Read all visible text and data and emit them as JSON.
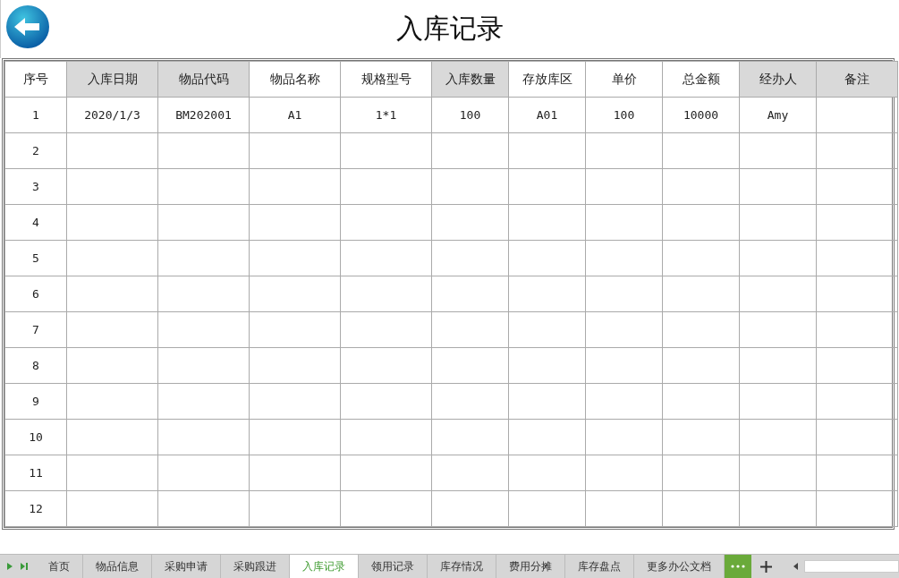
{
  "title": "入库记录",
  "table": {
    "columns": [
      {
        "label": "序号",
        "shaded": false
      },
      {
        "label": "入库日期",
        "shaded": true
      },
      {
        "label": "物品代码",
        "shaded": true
      },
      {
        "label": "物品名称",
        "shaded": false
      },
      {
        "label": "规格型号",
        "shaded": false
      },
      {
        "label": "入库数量",
        "shaded": true
      },
      {
        "label": "存放库区",
        "shaded": false
      },
      {
        "label": "单价",
        "shaded": false
      },
      {
        "label": "总金额",
        "shaded": false
      },
      {
        "label": "经办人",
        "shaded": true
      },
      {
        "label": "备注",
        "shaded": true
      }
    ],
    "rows": [
      [
        "1",
        "2020/1/3",
        "BM202001",
        "A1",
        "1*1",
        "100",
        "A01",
        "100",
        "10000",
        "Amy"
      ],
      [
        "2"
      ],
      [
        "3"
      ],
      [
        "4"
      ],
      [
        "5"
      ],
      [
        "6"
      ],
      [
        "7"
      ],
      [
        "8"
      ],
      [
        "9"
      ],
      [
        "10"
      ],
      [
        "11"
      ],
      [
        "12"
      ]
    ]
  },
  "sheet_tabs": [
    {
      "label": "首页",
      "selected": false
    },
    {
      "label": "物品信息",
      "selected": false
    },
    {
      "label": "采购申请",
      "selected": false
    },
    {
      "label": "采购跟进",
      "selected": false
    },
    {
      "label": "入库记录",
      "selected": true
    },
    {
      "label": "领用记录",
      "selected": false
    },
    {
      "label": "库存情况",
      "selected": false
    },
    {
      "label": "费用分摊",
      "selected": false
    },
    {
      "label": "库存盘点",
      "selected": false
    },
    {
      "label": "更多办公文档",
      "selected": false
    }
  ]
}
